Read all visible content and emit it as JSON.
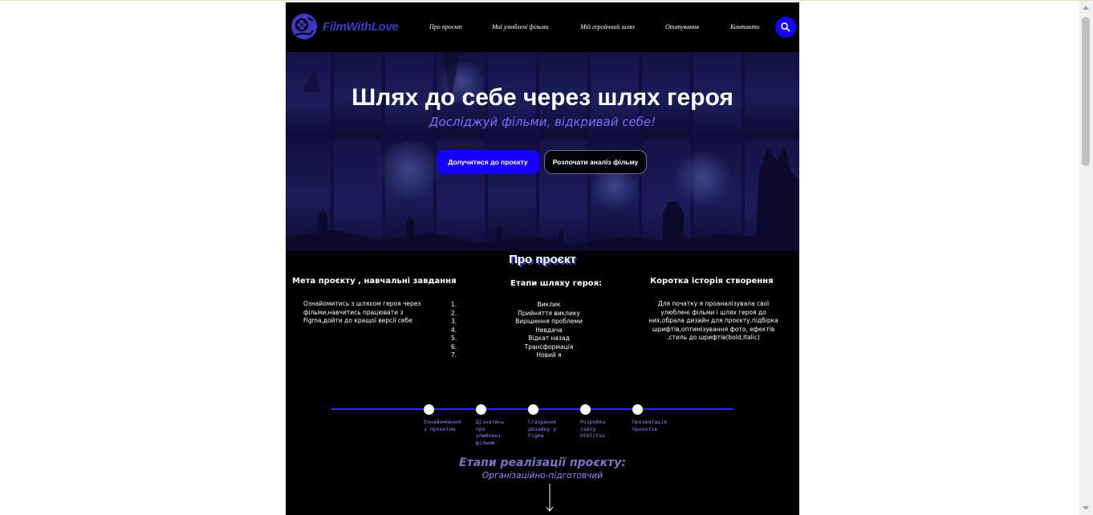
{
  "colors": {
    "accent": "#1500ff",
    "logo": "#3d38c6",
    "subtitle": "#7a72ff",
    "background": "#000000"
  },
  "header": {
    "logo_icon": "film-reel-icon",
    "logo_text": "FilmWithLove",
    "nav": [
      "Про проєкт",
      "Мої улюблені фільми",
      "Мій геройчний шлях",
      "Опитування",
      "Контакти"
    ],
    "search_icon": "search-icon"
  },
  "hero": {
    "title": "Шлях до себе через шлях героя",
    "subtitle": "Досліджуй фільми, відкривай себе!",
    "primary_button": "Долучитися до проєкту",
    "secondary_button": "Розпочати аналіз фільму"
  },
  "about": {
    "title": "Про проєкт",
    "goal": {
      "title": "Мета проєкту , навчальні завдання",
      "text": "Ознайомитись з шляхом героя через фільми,навчитись працювати з Figma,дойти до кращої версії себе"
    },
    "stages": {
      "title": "Етапи шляху героя:",
      "items": [
        "Виклик",
        "Прийняття виклику",
        "Вирішення проблеми",
        "Невдача",
        "Відкат назад",
        "Трансформація",
        "Новий я"
      ]
    },
    "history": {
      "title": "Коротка історія створення",
      "text": "Для початку я проаналізувала свої улюблені фільми і шлях героя до них,обрала дизайн для проєкту,підбірка шрифтів,оптимізування фото, ефектів ,стиль до шрифтів(bold,italic)"
    }
  },
  "timeline": [
    "Ознайомлення з проєктом",
    "Дізнатись про улюблені фільми",
    "Створення дизайну у Figma",
    "Розробка сайту Html/Css",
    "Презентація проєктів"
  ],
  "implementation": {
    "title": "Етапи реалізації проєкту:",
    "subtitle": "Організаційно-підготовчий",
    "arrow_icon": "arrow-down-icon"
  }
}
